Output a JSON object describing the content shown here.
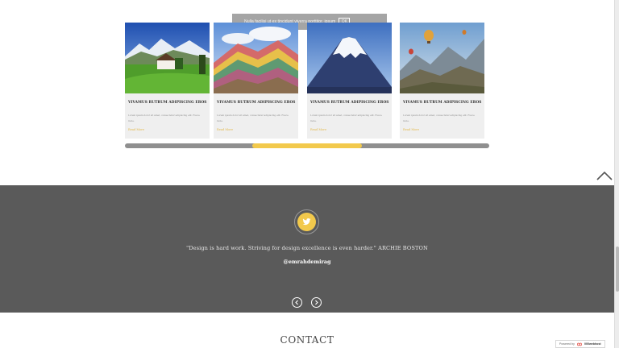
{
  "notice": {
    "text": "Nulla facilisi ut ex tincidunt viverra porttitor. ipsum",
    "button": "OK"
  },
  "cards": [
    {
      "title": "VIVAMUS RUTRUM ADIPISCING EROS",
      "excerpt": "Lorem ipsum dolor sit amet, consectetur adipiscing elit. Fusce mole.",
      "more": "Read More",
      "image": "alpine-meadow-house"
    },
    {
      "title": "VIVAMUS RUTRUM ADIPISCING EROS",
      "excerpt": "Lorem ipsum dolor sit amet, consectetur adipiscing elit. Fusce mole.",
      "more": "Read More",
      "image": "rainbow-mountain"
    },
    {
      "title": "VIVAMUS RUTRUM ADIPISCING EROS",
      "excerpt": "Lorem ipsum dolor sit amet, consectetur adipiscing elit. Fusce mole.",
      "more": "Read More",
      "image": "snow-volcano"
    },
    {
      "title": "VIVAMUS RUTRUM ADIPISCING EROS",
      "excerpt": "Lorem ipsum dolor sit amet, consectetur adipiscing elit. Fusce mole.",
      "more": "Read More",
      "image": "hot-air-balloons"
    }
  ],
  "testimonial": {
    "quote": "\"Design is hard work. Striving for design excellence is even harder.\" ARCHIE BOSTON",
    "handle": "@emrahdemirag",
    "icon": "twitter-icon"
  },
  "contact": {
    "heading": "CONTACT"
  },
  "powered": {
    "label": "Powered by",
    "brand": "000webhost"
  },
  "colors": {
    "accent": "#f2c94c",
    "section_bg": "#5a5a5a",
    "card_bg": "#efefef"
  }
}
